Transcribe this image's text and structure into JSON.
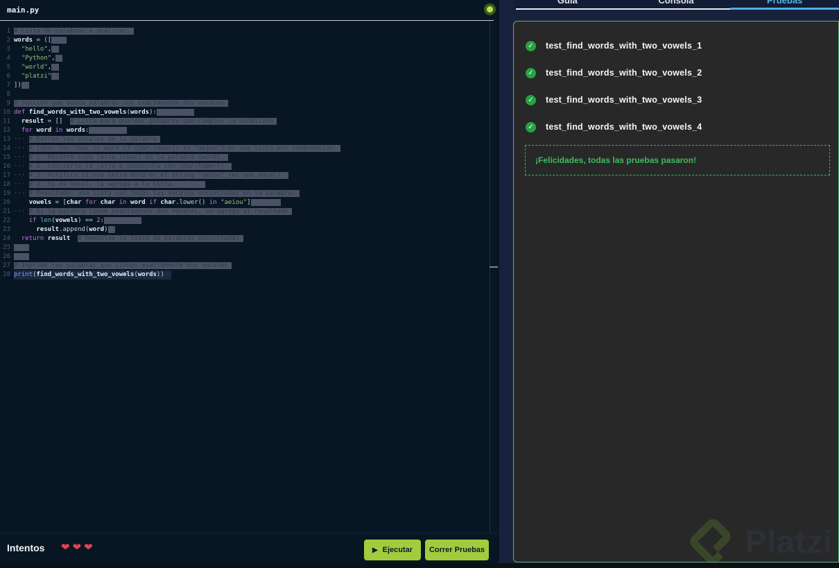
{
  "editor": {
    "filename": "main.py",
    "cursor_line": 28,
    "lines": [
      [
        [
          "cm",
          "# Lista de palabras a analizar"
        ],
        [
          "sel",
          "  "
        ]
      ],
      [
        [
          "v",
          "words"
        ],
        [
          "p",
          " = (["
        ],
        [
          "sel",
          "    "
        ]
      ],
      [
        [
          "p",
          "  "
        ],
        [
          "s",
          "\"hello\""
        ],
        [
          "p",
          ","
        ],
        [
          "sel",
          "  "
        ]
      ],
      [
        [
          "p",
          "  "
        ],
        [
          "s",
          "\"Python\""
        ],
        [
          "p",
          ","
        ],
        [
          "sel",
          "  "
        ]
      ],
      [
        [
          "p",
          "  "
        ],
        [
          "s",
          "\"world\""
        ],
        [
          "p",
          ","
        ],
        [
          "sel",
          "  "
        ]
      ],
      [
        [
          "p",
          "  "
        ],
        [
          "s",
          "\"platzi\""
        ],
        [
          "sel",
          "  "
        ]
      ],
      [
        [
          "p",
          "])"
        ],
        [
          "sel",
          "  "
        ]
      ],
      [],
      [
        [
          "cm",
          "# Función que busca palabras con exactamente dos vocales"
        ],
        [
          "sel",
          " "
        ]
      ],
      [
        [
          "k",
          "def "
        ],
        [
          "v",
          "find_words_with_two_vowels"
        ],
        [
          "p",
          "("
        ],
        [
          "v",
          "words"
        ],
        [
          "p",
          "):"
        ],
        [
          "sel",
          "          "
        ]
      ],
      [
        [
          "p",
          "  "
        ],
        [
          "v",
          "result"
        ],
        [
          "p",
          " = []  "
        ],
        [
          "cm",
          "# Lista para guardar palabras que cumplen la condición"
        ],
        [
          "sel",
          " "
        ]
      ],
      [
        [
          "p",
          "  "
        ],
        [
          "k",
          "for "
        ],
        [
          "v",
          "word"
        ],
        [
          "k",
          " in "
        ],
        [
          "v",
          "words"
        ],
        [
          "p",
          ":"
        ],
        [
          "sel",
          "          "
        ]
      ],
      [
        [
          "ws",
          "··· "
        ],
        [
          "cm",
          "# Extrae las vocales de la palabra"
        ],
        [
          "sel",
          " "
        ]
      ],
      [
        [
          "ws",
          "··· "
        ],
        [
          "cm",
          "# [char for char in word if char.lower() in \"aeiou\"] es una lista por comprensión:"
        ],
        [
          "sel",
          " "
        ]
      ],
      [
        [
          "ws",
          "··· "
        ],
        [
          "cm",
          "# 1. Recorre cada letra (char) en la palabra (word)."
        ],
        [
          "sel",
          " "
        ]
      ],
      [
        [
          "ws",
          "··· "
        ],
        [
          "cm",
          "# 2. Convierte la letra a minúscula con char.lower()."
        ],
        [
          "sel",
          " "
        ]
      ],
      [
        [
          "ws",
          "··· "
        ],
        [
          "cm",
          "# 3. Verifica si esa letra está en el string \"aeiou\" (es una vocal)."
        ],
        [
          "sel",
          " "
        ]
      ],
      [
        [
          "ws",
          "··· "
        ],
        [
          "cm",
          "# 4. Si es vocal, la agrega a la lista."
        ],
        [
          "sel",
          "        "
        ]
      ],
      [
        [
          "ws",
          "··· "
        ],
        [
          "cm",
          "# Resultado: una lista con todas las vocales encontradas en la palabra."
        ],
        [
          "sel",
          " "
        ]
      ],
      [
        [
          "p",
          "    "
        ],
        [
          "v",
          "vowels"
        ],
        [
          "p",
          " = ["
        ],
        [
          "v",
          "char"
        ],
        [
          "k",
          " for "
        ],
        [
          "v",
          "char"
        ],
        [
          "k",
          " in "
        ],
        [
          "v",
          "word"
        ],
        [
          "k",
          " if "
        ],
        [
          "v",
          "char"
        ],
        [
          "p",
          ".lower() "
        ],
        [
          "k",
          "in "
        ],
        [
          "s",
          "\"aeiou\""
        ],
        [
          "p",
          "]"
        ],
        [
          "sel",
          "        "
        ]
      ],
      [
        [
          "ws",
          "··· "
        ],
        [
          "cm",
          "# Si la palabra tiene exactamente dos vocales, se agrega al resultado"
        ],
        [
          "sel",
          " "
        ]
      ],
      [
        [
          "p",
          "    "
        ],
        [
          "k",
          "if "
        ],
        [
          "b",
          "len"
        ],
        [
          "p",
          "("
        ],
        [
          "v",
          "vowels"
        ],
        [
          "p",
          ") == "
        ],
        [
          "n",
          "2"
        ],
        [
          "p",
          ":"
        ],
        [
          "sel",
          "          "
        ]
      ],
      [
        [
          "p",
          "      "
        ],
        [
          "v",
          "result"
        ],
        [
          "p",
          ".append("
        ],
        [
          "v",
          "word"
        ],
        [
          "p",
          ")"
        ],
        [
          "sel",
          "  "
        ]
      ],
      [
        [
          "p",
          "  "
        ],
        [
          "k",
          "return "
        ],
        [
          "v",
          "result"
        ],
        [
          "p",
          "  "
        ],
        [
          "cm",
          "# Devuelve la lista de palabras encontradas"
        ],
        [
          "sel",
          " "
        ]
      ],
      [
        [
          "sel",
          "    "
        ]
      ],
      [
        [
          "sel",
          "    "
        ]
      ],
      [
        [
          "cm",
          "# Imprime las palabras que tienen exactamente dos vocales"
        ],
        [
          "sel",
          " "
        ]
      ],
      [
        [
          "f",
          "print"
        ],
        [
          "p",
          "("
        ],
        [
          "v",
          "find_words_with_two_vowels"
        ],
        [
          "p",
          "("
        ],
        [
          "v",
          "words"
        ],
        [
          "p",
          "))"
        ]
      ]
    ]
  },
  "footer": {
    "attempts_label": "Intentos",
    "hearts_count": 3,
    "heart_glyph": "❤",
    "run_label": "Ejecutar",
    "run_icon": "▶",
    "tests_label": "Correr Pruebas"
  },
  "tabs": {
    "items": [
      {
        "label": "Guía",
        "active": false
      },
      {
        "label": "Consola",
        "active": false
      },
      {
        "label": "Pruebas",
        "active": true
      }
    ]
  },
  "tests": {
    "check_glyph": "✓",
    "items": [
      {
        "label": "test_find_words_with_two_vowels_1",
        "status": "passed"
      },
      {
        "label": "test_find_words_with_two_vowels_2",
        "status": "passed"
      },
      {
        "label": "test_find_words_with_two_vowels_3",
        "status": "passed"
      },
      {
        "label": "test_find_words_with_two_vowels_4",
        "status": "passed"
      }
    ],
    "success_message": "¡Felicidades, todas las pruebas pasaron!"
  },
  "watermark": {
    "brand": "Platzi"
  },
  "colors": {
    "button_green": "#a3cc3d",
    "check_green": "#26a344",
    "success_green": "#3dbd62",
    "panel_border_green": "#57b570",
    "active_tab_blue": "#4fb0e8",
    "heart_red": "#e8414f",
    "status_dot_green": "#b8e455",
    "selection_gray": "#4a5263",
    "editor_bg": "#081624",
    "panel_bg": "#282828",
    "right_pane_bg": "#18223c"
  }
}
